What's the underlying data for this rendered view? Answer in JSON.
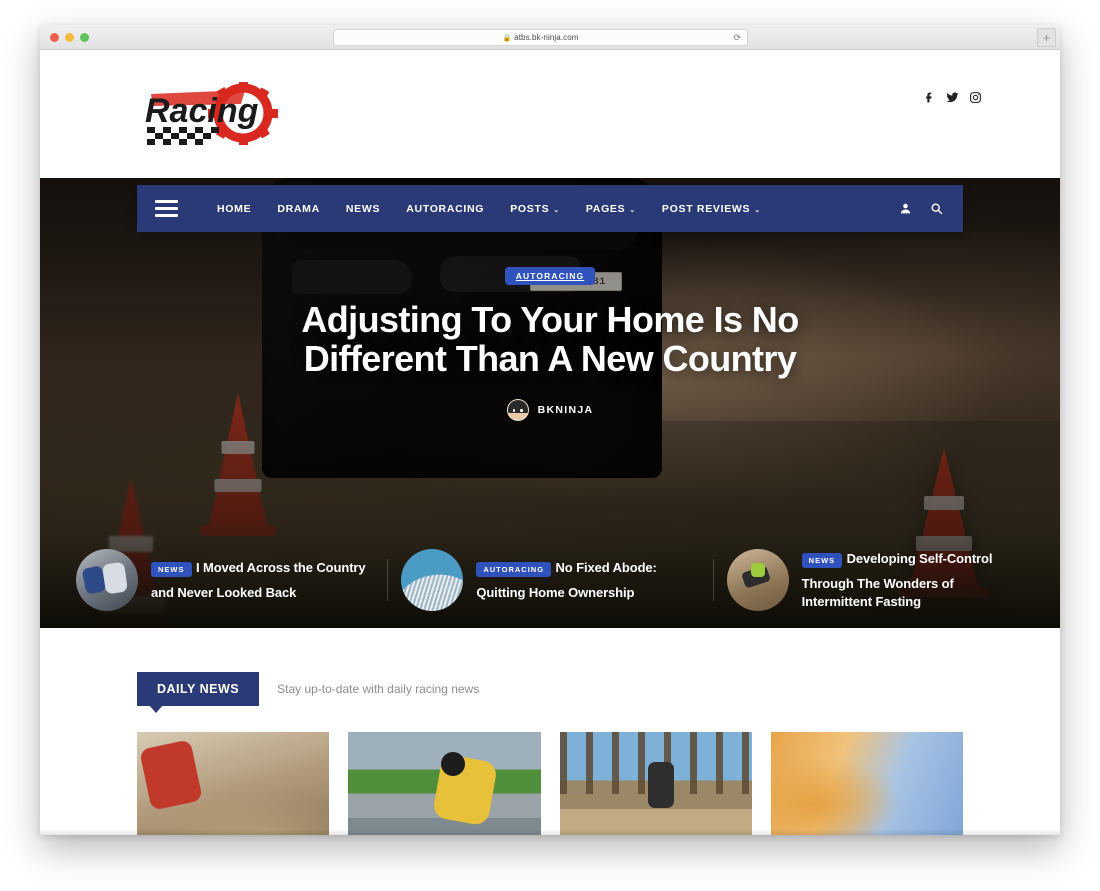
{
  "browser": {
    "url": "atbs.bk-ninja.com",
    "lock_icon": "lock-icon",
    "reload_icon": "reload-icon",
    "new_tab_label": "+",
    "traffic_lights": [
      "close",
      "minimize",
      "zoom"
    ]
  },
  "site": {
    "logo_text": "Racing",
    "social": [
      {
        "name": "facebook-icon",
        "label": "f"
      },
      {
        "name": "twitter-icon",
        "label": "t"
      },
      {
        "name": "instagram-icon",
        "label": "i"
      }
    ]
  },
  "nav": {
    "menu_icon": "hamburger-icon",
    "items": [
      {
        "label": "HOME",
        "has_caret": false
      },
      {
        "label": "DRAMA",
        "has_caret": false
      },
      {
        "label": "NEWS",
        "has_caret": false
      },
      {
        "label": "AUTORACING",
        "has_caret": false
      },
      {
        "label": "POSTS",
        "has_caret": true
      },
      {
        "label": "PAGES",
        "has_caret": true
      },
      {
        "label": "POST REVIEWS",
        "has_caret": true
      }
    ],
    "caret": "⌄",
    "account_icon": "user-icon",
    "search_icon": "search-icon",
    "bar_color": "#2a3a77"
  },
  "hero": {
    "badge": "AUTORACING",
    "title": "Adjusting To Your Home Is No Different Than A New Country",
    "author": "BKNINJA",
    "plate_text": "UP16J7181",
    "badge_color": "#2f52bd"
  },
  "hero_cards": [
    {
      "badge": "NEWS",
      "title": "I Moved Across the Country and Never Looked Back",
      "thumb": "cycling-thumbnail"
    },
    {
      "badge": "AUTORACING",
      "title": "No Fixed Abode: Quitting Home Ownership",
      "thumb": "wave-thumbnail"
    },
    {
      "badge": "NEWS",
      "title": "Developing Self-Control Through The Wonders of Intermittent Fasting",
      "thumb": "dirtbike-thumbnail"
    }
  ],
  "daily_news": {
    "tab_label": "DAILY NEWS",
    "note": "Stay up-to-date with daily racing news",
    "cards": [
      {
        "image": "motocross-red-rider-image"
      },
      {
        "image": "yellow-roadracer-image"
      },
      {
        "image": "forest-dirtbike-image"
      },
      {
        "image": "dust-cloud-sky-image"
      }
    ]
  }
}
